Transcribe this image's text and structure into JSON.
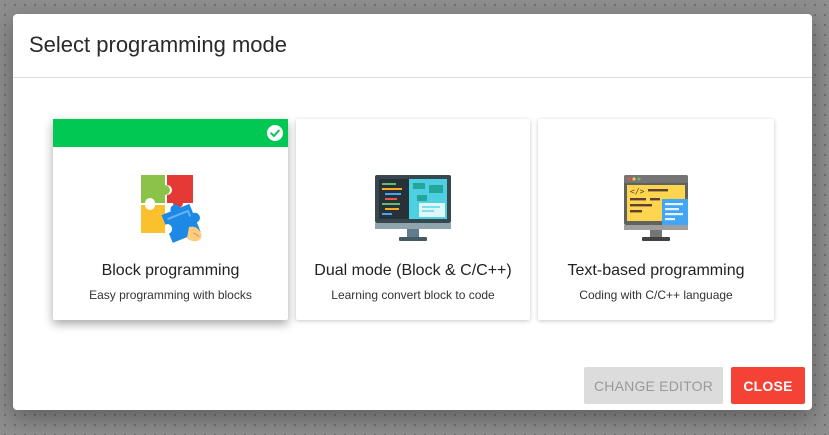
{
  "dialog": {
    "title": "Select programming mode"
  },
  "modes": [
    {
      "title": "Block programming",
      "subtitle": "Easy programming with blocks",
      "icon": "puzzle-icon",
      "selected": true
    },
    {
      "title": "Dual mode (Block & C/C++)",
      "subtitle": "Learning convert block to code",
      "icon": "monitor-code-icon",
      "selected": false
    },
    {
      "title": "Text-based programming",
      "subtitle": "Coding with C/C++ language",
      "icon": "code-monitor-icon",
      "selected": false
    }
  ],
  "actions": {
    "change_editor_label": "CHANGE EDITOR",
    "close_label": "CLOSE"
  },
  "colors": {
    "selected_bar": "#00c853",
    "close_button": "#f44336",
    "disabled_button": "#dcdcdc"
  }
}
